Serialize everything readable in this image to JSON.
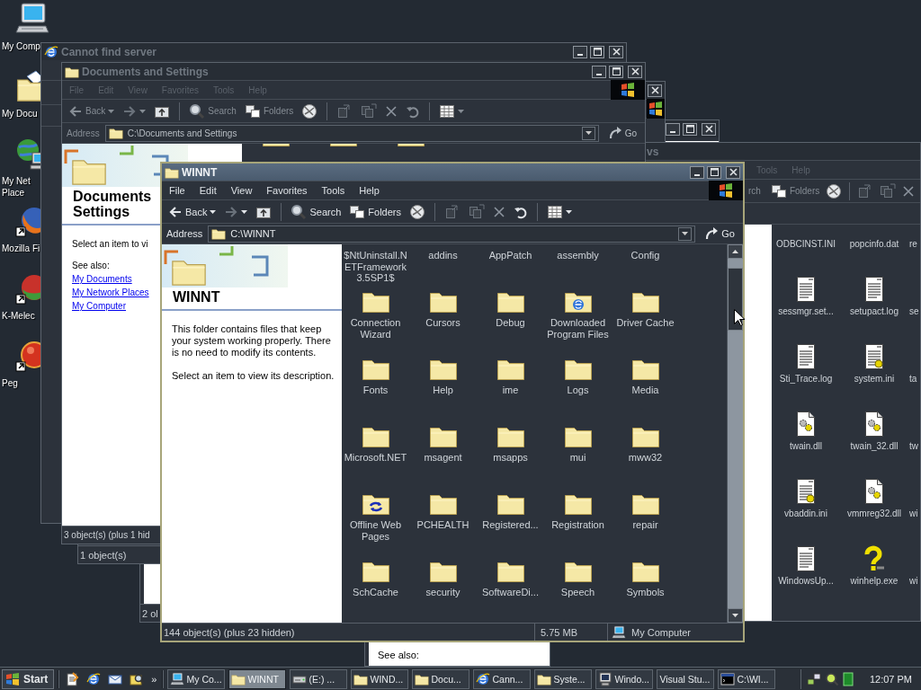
{
  "desktop_icons": [
    {
      "kind": "computer",
      "label": "My Comp"
    },
    {
      "kind": "documents",
      "label": "My Docu"
    },
    {
      "kind": "network",
      "label": "My Net\nPlace"
    },
    {
      "kind": "firefox",
      "label": "Mozilla Fi"
    },
    {
      "kind": "kmeleon",
      "label": "K-Melec"
    },
    {
      "kind": "pegasus",
      "label": "Peg"
    }
  ],
  "windows": [
    {
      "kind": "browser",
      "title": "Cannot find server",
      "active": false
    },
    {
      "kind": "partial",
      "active": false,
      "status": "2 ol"
    },
    {
      "kind": "partial",
      "active": false,
      "status": "1 object(s)"
    },
    {
      "kind": "listing",
      "active": false,
      "title": "vs",
      "menu": [
        "Tools",
        "Help"
      ],
      "search": "rch",
      "folders": "Folders",
      "files": [
        {
          "label": "ODBCINST.INI"
        },
        {
          "label": "popcinfo.dat"
        },
        {
          "label": "re"
        },
        {
          "label": "sessmgr.set...",
          "kind": "text"
        },
        {
          "label": "setupact.log",
          "kind": "text"
        },
        {
          "label": "se"
        },
        {
          "label": "Sti_Trace.log",
          "kind": "text"
        },
        {
          "label": "system.ini",
          "kind": "ini"
        },
        {
          "label": "ta"
        },
        {
          "label": "twain.dll",
          "kind": "dll"
        },
        {
          "label": "twain_32.dll",
          "kind": "dll"
        },
        {
          "label": "tw"
        },
        {
          "label": "vbaddin.ini",
          "kind": "ini"
        },
        {
          "label": "vmmreg32.dll",
          "kind": "dll"
        },
        {
          "label": "wi"
        },
        {
          "label": "WindowsUp...",
          "kind": "text"
        },
        {
          "label": "winhelp.exe",
          "kind": "help"
        },
        {
          "label": "wi"
        }
      ]
    },
    {
      "kind": "explorer",
      "active": false,
      "title": "Documents and Settings",
      "menu": [
        "File",
        "Edit",
        "View",
        "Favorites",
        "Tools",
        "Help"
      ],
      "back": "Back",
      "search": "Search",
      "folders": "Folders",
      "address_label": "Address",
      "address": "C:\\Documents and Settings",
      "go": "Go",
      "panel": {
        "heading": "Documents\nSettings",
        "lines": [
          "Select an item to vi"
        ],
        "see_also": "See also:",
        "links": [
          "My Documents",
          "My Network Places",
          "My Computer"
        ]
      },
      "files": [
        {
          "kind": "folder"
        },
        {
          "kind": "folder"
        },
        {
          "kind": "folder"
        }
      ],
      "status": [
        "3 object(s) (plus 1 hid"
      ]
    },
    {
      "kind": "panel",
      "see_also": "See also:"
    },
    {
      "kind": "explorer",
      "active": true,
      "title": "WINNT",
      "menu": [
        "File",
        "Edit",
        "View",
        "Favorites",
        "Tools",
        "Help"
      ],
      "back": "Back",
      "search": "Search",
      "folders": "Folders",
      "address_label": "Address",
      "address": "C:\\WINNT",
      "go": "Go",
      "panel": {
        "heading": "WINNT",
        "lines": [
          "This folder contains files that keep your system working properly. There is no need to modify its contents.",
          "Select an item to view its description."
        ]
      },
      "files": [
        {
          "label": "$NtUninstall.NETFramework3.5SP1$"
        },
        {
          "label": "addins"
        },
        {
          "label": "AppPatch"
        },
        {
          "label": "assembly"
        },
        {
          "label": "Config"
        },
        {
          "label": "Connection Wizard",
          "kind": "folder"
        },
        {
          "label": "Cursors",
          "kind": "folder"
        },
        {
          "label": "Debug",
          "kind": "folder"
        },
        {
          "label": "Downloaded Program Files",
          "kind": "web-folder"
        },
        {
          "label": "Driver Cache",
          "kind": "folder"
        },
        {
          "label": "Fonts",
          "kind": "folder"
        },
        {
          "label": "Help",
          "kind": "folder"
        },
        {
          "label": "ime",
          "kind": "folder"
        },
        {
          "label": "Logs",
          "kind": "folder"
        },
        {
          "label": "Media",
          "kind": "folder"
        },
        {
          "label": "Microsoft.NET",
          "kind": "folder"
        },
        {
          "label": "msagent",
          "kind": "folder"
        },
        {
          "label": "msapps",
          "kind": "folder"
        },
        {
          "label": "mui",
          "kind": "folder"
        },
        {
          "label": "mww32",
          "kind": "folder"
        },
        {
          "label": "Offline Web Pages",
          "kind": "sync-folder"
        },
        {
          "label": "PCHEALTH",
          "kind": "folder"
        },
        {
          "label": "Registered...",
          "kind": "folder"
        },
        {
          "label": "Registration",
          "kind": "folder"
        },
        {
          "label": "repair",
          "kind": "folder"
        },
        {
          "label": "SchCache",
          "kind": "folder"
        },
        {
          "label": "security",
          "kind": "folder"
        },
        {
          "label": "SoftwareDi...",
          "kind": "folder"
        },
        {
          "label": "Speech",
          "kind": "folder"
        },
        {
          "label": "Symbols",
          "kind": "folder"
        }
      ],
      "status": [
        "144 object(s) (plus 23 hidden)",
        "5.75 MB",
        "My Computer"
      ]
    }
  ],
  "taskbar": {
    "start": "Start",
    "quick_launch": [
      {
        "kind": "notepad"
      },
      {
        "kind": "browser"
      },
      {
        "kind": "mail"
      },
      {
        "kind": "search"
      }
    ],
    "more": "»",
    "tasks": [
      {
        "label": "My Co...",
        "kind": "computer",
        "selected": false
      },
      {
        "label": "WINNT",
        "kind": "folder",
        "selected": true
      },
      {
        "label": "(E:) ...",
        "kind": "drive",
        "selected": false
      },
      {
        "label": "WIND...",
        "kind": "folder",
        "selected": false
      },
      {
        "label": "Docu...",
        "kind": "folder",
        "selected": false
      },
      {
        "label": "Cann...",
        "kind": "browser",
        "selected": false
      },
      {
        "label": "Syste...",
        "kind": "folder",
        "selected": false
      },
      {
        "label": "Windo...",
        "kind": "monitor",
        "selected": false
      },
      {
        "label": "Visual Stu...",
        "kind": "plain",
        "selected": false
      },
      {
        "label": "C:\\WI...",
        "kind": "console",
        "selected": false
      }
    ],
    "clock": "12:07 PM"
  }
}
